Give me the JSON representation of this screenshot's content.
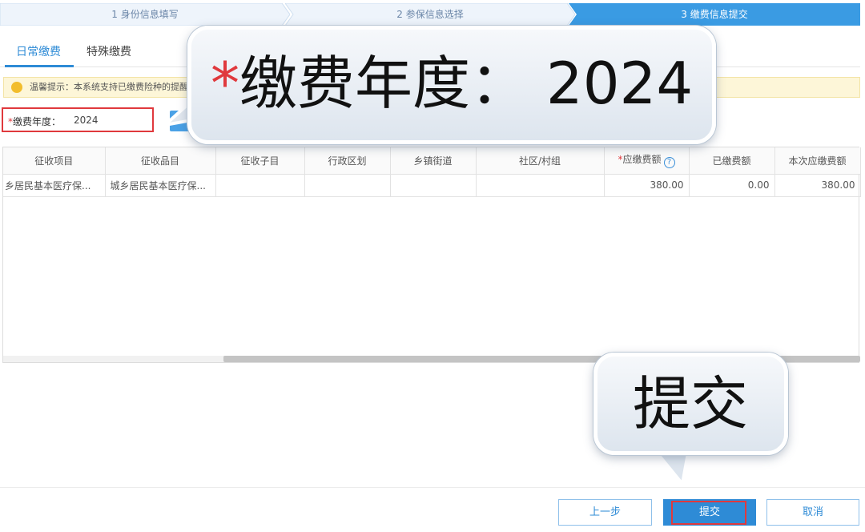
{
  "stepper": {
    "steps": [
      {
        "label": "1 身份信息填写",
        "state": "done"
      },
      {
        "label": "2 参保信息选择",
        "state": "done"
      },
      {
        "label": "3 缴费信息提交",
        "state": "active"
      }
    ],
    "active_color": "#3a9be3",
    "inactive_color": "#eef4fb"
  },
  "tabs": [
    {
      "label": "日常缴费",
      "active": true
    },
    {
      "label": "特殊缴费",
      "active": false
    }
  ],
  "notice": {
    "text": "温馨提示：本系统支持已缴费险种的提醒"
  },
  "year_field": {
    "required_mark": "*",
    "label": "缴费年度：",
    "value": "2024"
  },
  "table": {
    "columns": [
      "征收项目",
      "征收品目",
      "征收子目",
      "行政区划",
      "乡镇街道",
      "社区/村组",
      "应缴费额",
      "已缴费额",
      "本次应缴费额"
    ],
    "required_column_mark": "*",
    "rows": [
      [
        "乡居民基本医疗保...",
        "城乡居民基本医疗保...",
        "",
        "",
        "",
        "",
        "380.00",
        "0.00",
        "380.00"
      ]
    ]
  },
  "footer": {
    "prev_label": "上一步",
    "submit_label": "提交",
    "cancel_label": "取消"
  },
  "callouts": {
    "year": {
      "star": "*",
      "text": "缴费年度：  2024"
    },
    "submit": {
      "text": "提交"
    }
  },
  "colors": {
    "primary": "#2e8bd6",
    "highlight_red": "#e0393d",
    "notice_bg": "#fdf6d8"
  }
}
